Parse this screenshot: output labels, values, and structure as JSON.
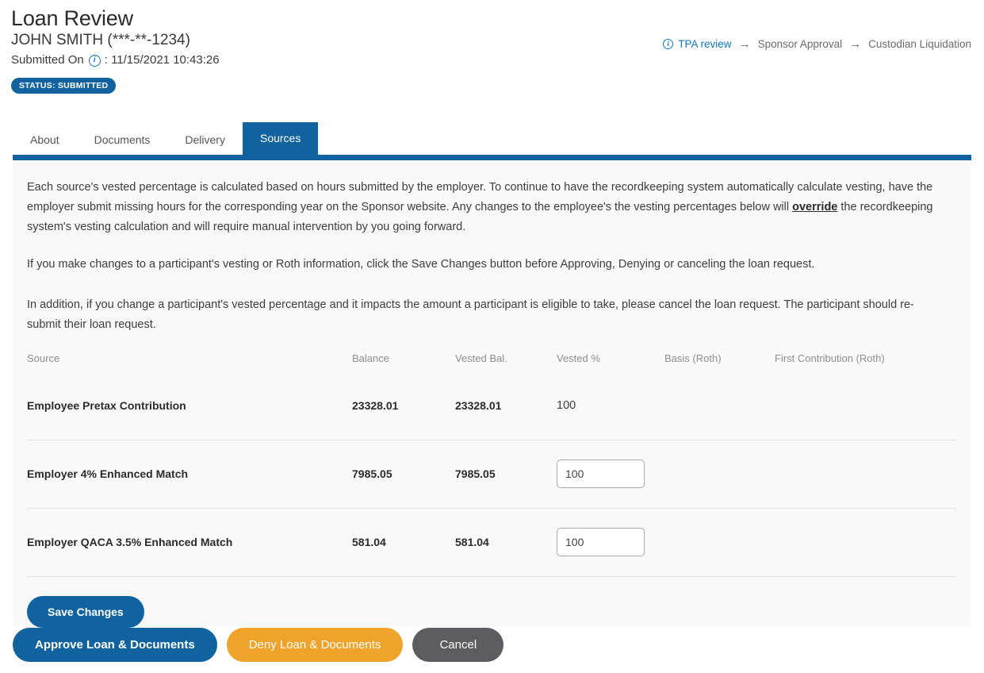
{
  "header": {
    "title": "Loan Review",
    "participant": "JOHN SMITH (***-**-1234)",
    "submitted_label": "Submitted On",
    "info_icon": "info-icon",
    "submitted_separator": ":",
    "submitted_value": "11/15/2021 10:43:26",
    "status_badge": "STATUS: SUBMITTED"
  },
  "breadcrumb": {
    "info_icon": "info-icon",
    "arrow": "→",
    "steps": [
      {
        "label": "TPA review",
        "active": true
      },
      {
        "label": "Sponsor Approval",
        "active": false
      },
      {
        "label": "Custodian Liquidation",
        "active": false
      }
    ]
  },
  "tabs": [
    {
      "label": "About",
      "active": false
    },
    {
      "label": "Documents",
      "active": false
    },
    {
      "label": "Delivery",
      "active": false
    },
    {
      "label": "Sources",
      "active": true
    }
  ],
  "content": {
    "paragraph1_part1": "Each source's vested percentage is calculated based on hours submitted by the employer. To continue to have the recordkeeping system automatically calculate vesting, have the employer submit missing hours for the corresponding year on the Sponsor website. Any changes to the employee's the vesting percentages below will ",
    "paragraph1_override": "override",
    "paragraph1_part2": " the recordkeeping system's vesting calculation and will require manual intervention by you going forward.",
    "paragraph2": "If you make changes to a participant's vesting or Roth information, click the Save Changes button before Approving, Denying or canceling the loan request.",
    "paragraph3": "In addition, if you change a participant's vested percentage and it impacts the amount a participant is eligible to take, please cancel the loan request. The participant should re-submit their loan request."
  },
  "table": {
    "headers": {
      "source": "Source",
      "balance": "Balance",
      "vested_balance": "Vested Bal.",
      "vested_pct": "Vested %",
      "basis_roth": "Basis (Roth)",
      "first_contribution_roth": "First Contribution (Roth)"
    },
    "rows": [
      {
        "source": "Employee Pretax Contribution",
        "balance": "23328.01",
        "vested_balance": "23328.01",
        "vested_pct": "100",
        "vested_pct_editable": false,
        "basis_roth": "",
        "first_contribution_roth": ""
      },
      {
        "source": "Employer 4% Enhanced Match",
        "balance": "7985.05",
        "vested_balance": "7985.05",
        "vested_pct": "100",
        "vested_pct_editable": true,
        "basis_roth": "",
        "first_contribution_roth": ""
      },
      {
        "source": "Employer QACA 3.5% Enhanced Match",
        "balance": "581.04",
        "vested_balance": "581.04",
        "vested_pct": "100",
        "vested_pct_editable": true,
        "basis_roth": "",
        "first_contribution_roth": ""
      }
    ]
  },
  "buttons": {
    "save_changes": "Save Changes",
    "approve": "Approve Loan & Documents",
    "deny": "Deny Loan & Documents",
    "cancel": "Cancel"
  },
  "colors": {
    "brand_blue": "#10639e",
    "link_blue": "#1176bc",
    "warning_orange": "#f0a32a",
    "neutral_gray": "#5d5d61",
    "panel_bg": "#f9f9fa"
  }
}
